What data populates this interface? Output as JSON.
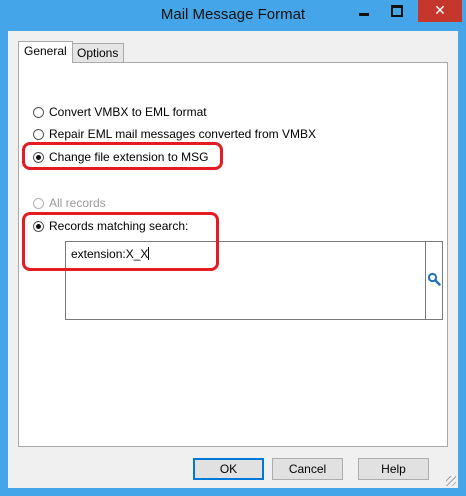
{
  "window": {
    "title": "Mail Message Format",
    "minimize_label": "",
    "maximize_label": "",
    "close_glyph": "✕"
  },
  "tabs": [
    {
      "label": "General",
      "selected": true
    },
    {
      "label": "Options",
      "selected": false
    }
  ],
  "format_options": [
    {
      "label": "Convert VMBX to EML format",
      "checked": false
    },
    {
      "label": "Repair EML mail messages converted from VMBX",
      "checked": false
    },
    {
      "label": "Change file extension to MSG",
      "checked": true
    }
  ],
  "record_options": [
    {
      "label": "All records",
      "checked": false,
      "disabled": true
    },
    {
      "label": "Records matching search:",
      "checked": true,
      "disabled": false
    }
  ],
  "search": {
    "value": "extension:X_X",
    "icon": "magnifier-icon"
  },
  "buttons": {
    "ok": "OK",
    "cancel": "Cancel",
    "help": "Help"
  },
  "colors": {
    "frame": "#44a6e8",
    "close_button": "#c5362d",
    "annotation": "#e31b23",
    "search_icon": "#1f6fb5"
  }
}
